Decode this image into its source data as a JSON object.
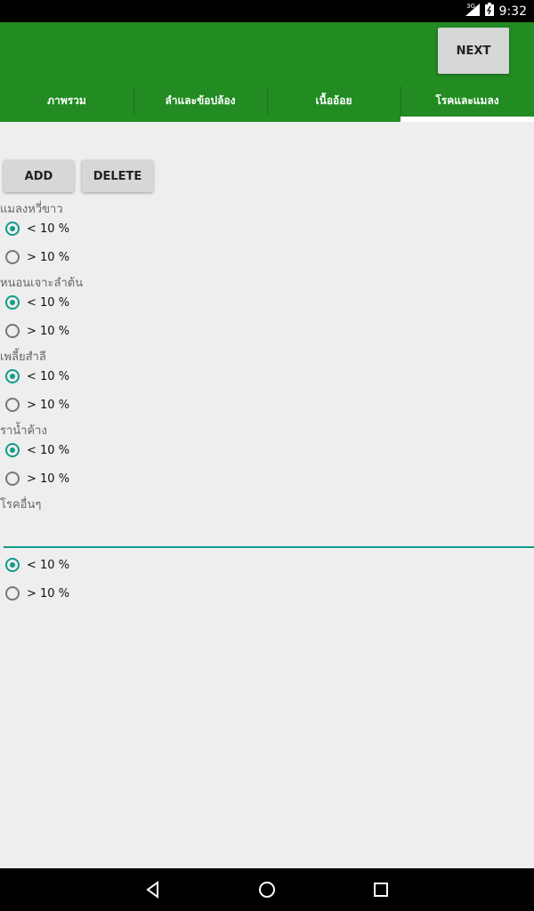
{
  "status_bar": {
    "signal_label": "3G",
    "time": "9:32"
  },
  "header": {
    "next_label": "NEXT"
  },
  "tabs": [
    {
      "label": "ภาพรวม",
      "active": false
    },
    {
      "label": "ลำและข้อปล้อง",
      "active": false
    },
    {
      "label": "เนื้ออ้อย",
      "active": false
    },
    {
      "label": "โรคและแมลง",
      "active": true
    }
  ],
  "actions": {
    "add_label": "ADD",
    "delete_label": "DELETE"
  },
  "groups": [
    {
      "title": "แมลงหวี่ขาว",
      "options": [
        "< 10 %",
        "> 10 %"
      ],
      "selected": 0
    },
    {
      "title": "หนอนเจาะลำต้น",
      "options": [
        "< 10 %",
        "> 10 %"
      ],
      "selected": 0
    },
    {
      "title": "เพลี้ยสำลี",
      "options": [
        "< 10 %",
        "> 10 %"
      ],
      "selected": 0
    },
    {
      "title": "ราน้ำค้าง",
      "options": [
        "< 10 %",
        "> 10 %"
      ],
      "selected": 0
    }
  ],
  "other": {
    "title": "โรคอื่นๆ",
    "input_value": "",
    "options": [
      "< 10 %",
      "> 10 %"
    ],
    "selected": 0
  },
  "colors": {
    "appbar": "#228B22",
    "accent": "#139a8a",
    "background": "#eeeeee"
  },
  "nav": {
    "back_icon": "back-triangle-icon",
    "home_icon": "home-circle-icon",
    "recents_icon": "recents-square-icon"
  }
}
